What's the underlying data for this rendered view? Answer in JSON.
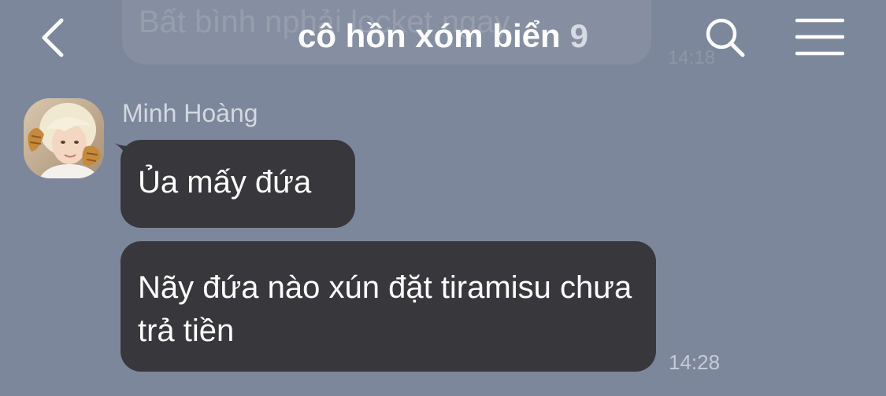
{
  "header": {
    "title": "cô hồn xóm biển",
    "member_count": "9",
    "back_icon": "chevron-left-icon",
    "search_icon": "search-icon",
    "menu_icon": "hamburger-menu-icon"
  },
  "previous_message": {
    "text": "Bất bình nphải locket ngay",
    "time": "14:18"
  },
  "message_group": {
    "sender_name": "Minh Hoàng",
    "avatar_icon": "user-avatar",
    "messages": [
      {
        "text": "Ủa mấy đứa"
      },
      {
        "text": "Nãy đứa nào xún đặt tiramisu chưa trả tiền"
      }
    ],
    "time": "14:28"
  },
  "colors": {
    "background": "#7c879b",
    "bubble": "#38383c",
    "text_white": "#ffffff"
  }
}
